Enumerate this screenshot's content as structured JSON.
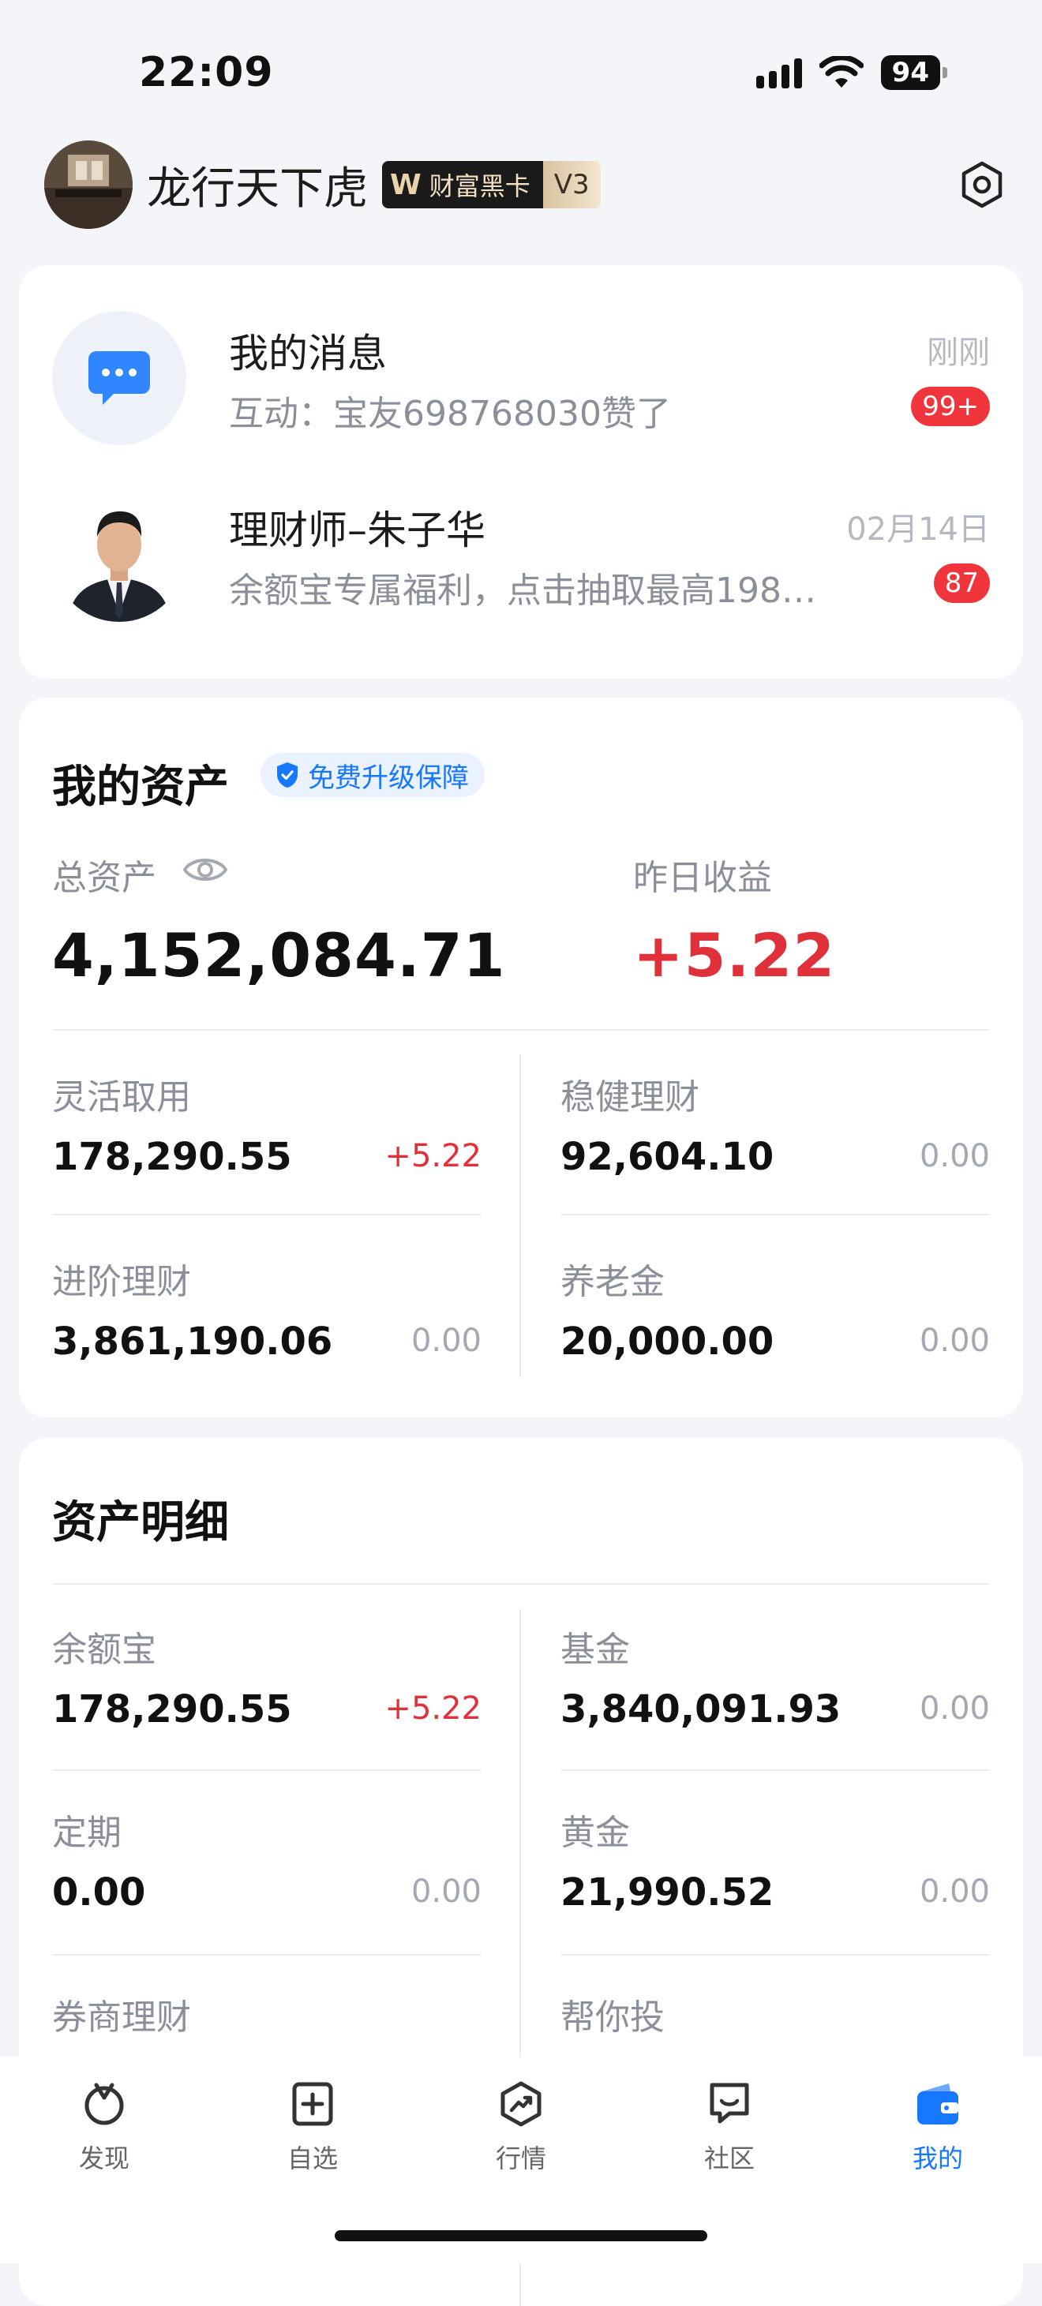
{
  "status_bar": {
    "time": "22:09",
    "battery": "94"
  },
  "profile": {
    "username": "龙行天下虎",
    "vip_card": "财富黑卡",
    "vip_level": "V3",
    "icons": {
      "avatar": "avatar-photo",
      "settings": "settings-hexagon-icon"
    }
  },
  "messages": [
    {
      "title": "我的消息",
      "subtitle": "互动：宝友698768030赞了",
      "time": "刚刚",
      "badge": "99+",
      "icon": "chat-bubble-icon"
    },
    {
      "title": "理财师–朱子华",
      "subtitle": "余额宝专属福利，点击抽取最高198…",
      "time": "02月14日",
      "badge": "87",
      "icon": "advisor-photo"
    }
  ],
  "assets": {
    "title": "我的资产",
    "guarantee_label": "免费升级保障",
    "total_label": "总资产",
    "total_value": "4,152,084.71",
    "yesterday_label": "昨日收益",
    "yesterday_value": "+5.22",
    "items": [
      {
        "label": "灵活取用",
        "value": "178,290.55",
        "change": "+5.22",
        "positive": true
      },
      {
        "label": "稳健理财",
        "value": "92,604.10",
        "change": "0.00",
        "positive": false
      },
      {
        "label": "进阶理财",
        "value": "3,861,190.06",
        "change": "0.00",
        "positive": false
      },
      {
        "label": "养老金",
        "value": "20,000.00",
        "change": "0.00",
        "positive": false
      }
    ]
  },
  "detail": {
    "title": "资产明细",
    "items": [
      {
        "label": "余额宝",
        "value": "178,290.55",
        "change": "+5.22",
        "positive": true
      },
      {
        "label": "基金",
        "value": "3,840,091.93",
        "change": "0.00",
        "positive": false
      },
      {
        "label": "定期",
        "value": "0.00",
        "change": "0.00",
        "positive": false
      },
      {
        "label": "黄金",
        "value": "21,990.52",
        "change": "0.00",
        "positive": false
      },
      {
        "label": "券商理财",
        "value": "",
        "change": "",
        "positive": false
      },
      {
        "label": "帮你投",
        "value": "",
        "change": "",
        "positive": false
      }
    ]
  },
  "tabs": [
    {
      "label": "发现",
      "icon": "discover-icon",
      "active": false
    },
    {
      "label": "自选",
      "icon": "add-watchlist-icon",
      "active": false
    },
    {
      "label": "行情",
      "icon": "market-trend-icon",
      "active": false
    },
    {
      "label": "社区",
      "icon": "community-icon",
      "active": false
    },
    {
      "label": "我的",
      "icon": "wallet-icon",
      "active": true
    }
  ],
  "colors": {
    "accent_blue": "#1677ff",
    "gain_red": "#e0313b",
    "badge_red": "#f0353c",
    "background": "#f3f5f9"
  }
}
